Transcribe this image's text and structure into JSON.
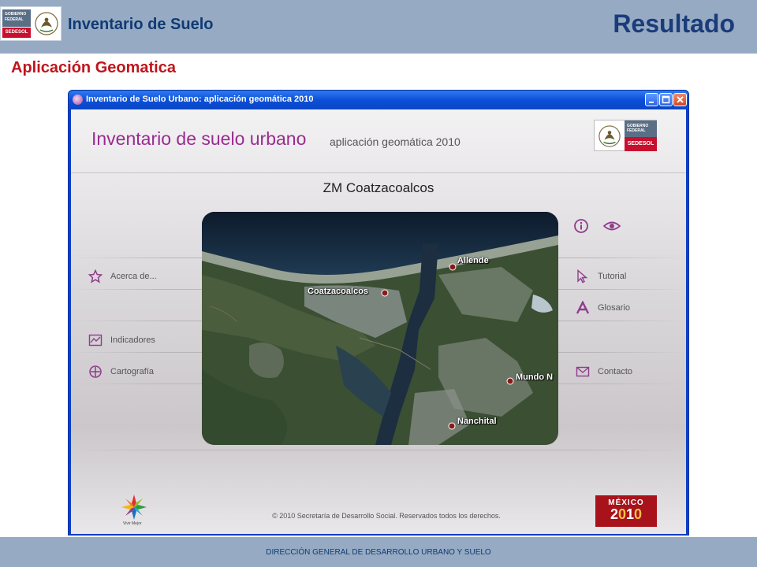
{
  "header": {
    "title": "Inventario de Suelo",
    "result_label": "Resultado",
    "logo_gobierno": "GOBIERNO FEDERAL",
    "logo_sedesol": "SEDESOL"
  },
  "section_title": "Aplicación Geomatica",
  "window": {
    "title": "Inventario de Suelo Urbano: aplicación geomática 2010",
    "app_title": "Inventario de suelo urbano",
    "app_subtitle": "aplicación geomática 2010",
    "region": "ZM Coatzacoalcos",
    "logo_gobierno": "GOBIERNO FEDERAL",
    "logo_sedesol": "SEDESOL",
    "menu_left": [
      {
        "label": "Acerca de...",
        "icon": "star-icon"
      },
      {
        "label": "Indicadores",
        "icon": "chart-icon"
      },
      {
        "label": "Cartografía",
        "icon": "crosshair-icon"
      }
    ],
    "menu_right": [
      {
        "label": "Tutorial",
        "icon": "cursor-icon"
      },
      {
        "label": "Glosario",
        "icon": "letter-a-icon"
      },
      {
        "label": "Contacto",
        "icon": "envelope-icon"
      }
    ],
    "top_icons": [
      "info-icon",
      "eye-icon"
    ],
    "map_labels": [
      "Allende",
      "Coatzacoalcos",
      "Mundo N",
      "Nanchital"
    ],
    "copyright": "© 2010 Secretaría de Desarrollo Social. Reservados todos los derechos.",
    "vivir_mejor": "Vivir Mejor",
    "mexico_logo": {
      "country": "MÉXICO",
      "year_a": "2",
      "year_b": "0",
      "year_c": "1",
      "year_d": "0"
    }
  },
  "footer": "DIRECCIÓN GENERAL DE DESARROLLO URBANO Y SUELO",
  "colors": {
    "header_bg": "#96abc3",
    "accent_red": "#c0141c",
    "app_purple": "#9a2b91",
    "titlebar_blue": "#0b4fd8"
  }
}
